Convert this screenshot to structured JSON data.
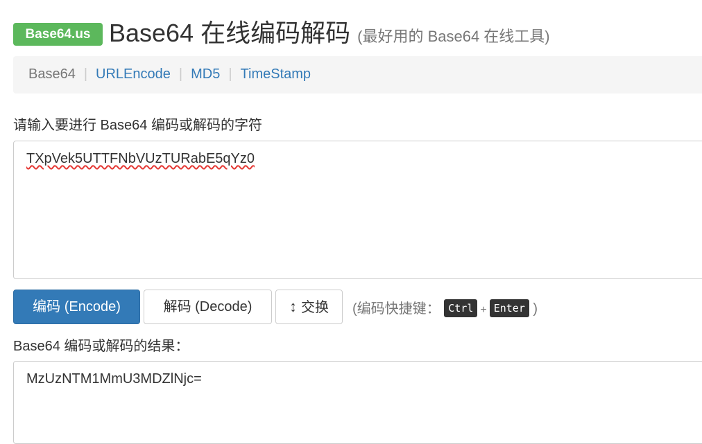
{
  "brand": {
    "badge": "Base64.us"
  },
  "header": {
    "title": "Base64 在线编码解码",
    "subtitle": "(最好用的 Base64 在线工具)"
  },
  "nav": {
    "items": [
      {
        "label": "Base64",
        "active": true
      },
      {
        "label": "URLEncode",
        "active": false
      },
      {
        "label": "MD5",
        "active": false
      },
      {
        "label": "TimeStamp",
        "active": false
      }
    ],
    "separator": "|"
  },
  "input": {
    "label": "请输入要进行 Base64 编码或解码的字符",
    "value": "TXpVek5UTTFNbVUzTURabE5qYz0"
  },
  "actions": {
    "encode_label": "编码 (Encode)",
    "decode_label": "解码 (Decode)",
    "swap_icon": "↕",
    "swap_label": "交换"
  },
  "shortcut": {
    "prefix": "(编码快捷键：",
    "key1": "Ctrl",
    "plus": "+",
    "key2": "Enter",
    "suffix": ")"
  },
  "result": {
    "label": "Base64 编码或解码的结果：",
    "value": "MzUzNTM1MmU3MDZlNjc="
  },
  "colors": {
    "brand_green": "#5cb85c",
    "primary_blue": "#337ab7",
    "link_blue": "#337ab7",
    "nav_bg": "#f5f5f5"
  }
}
